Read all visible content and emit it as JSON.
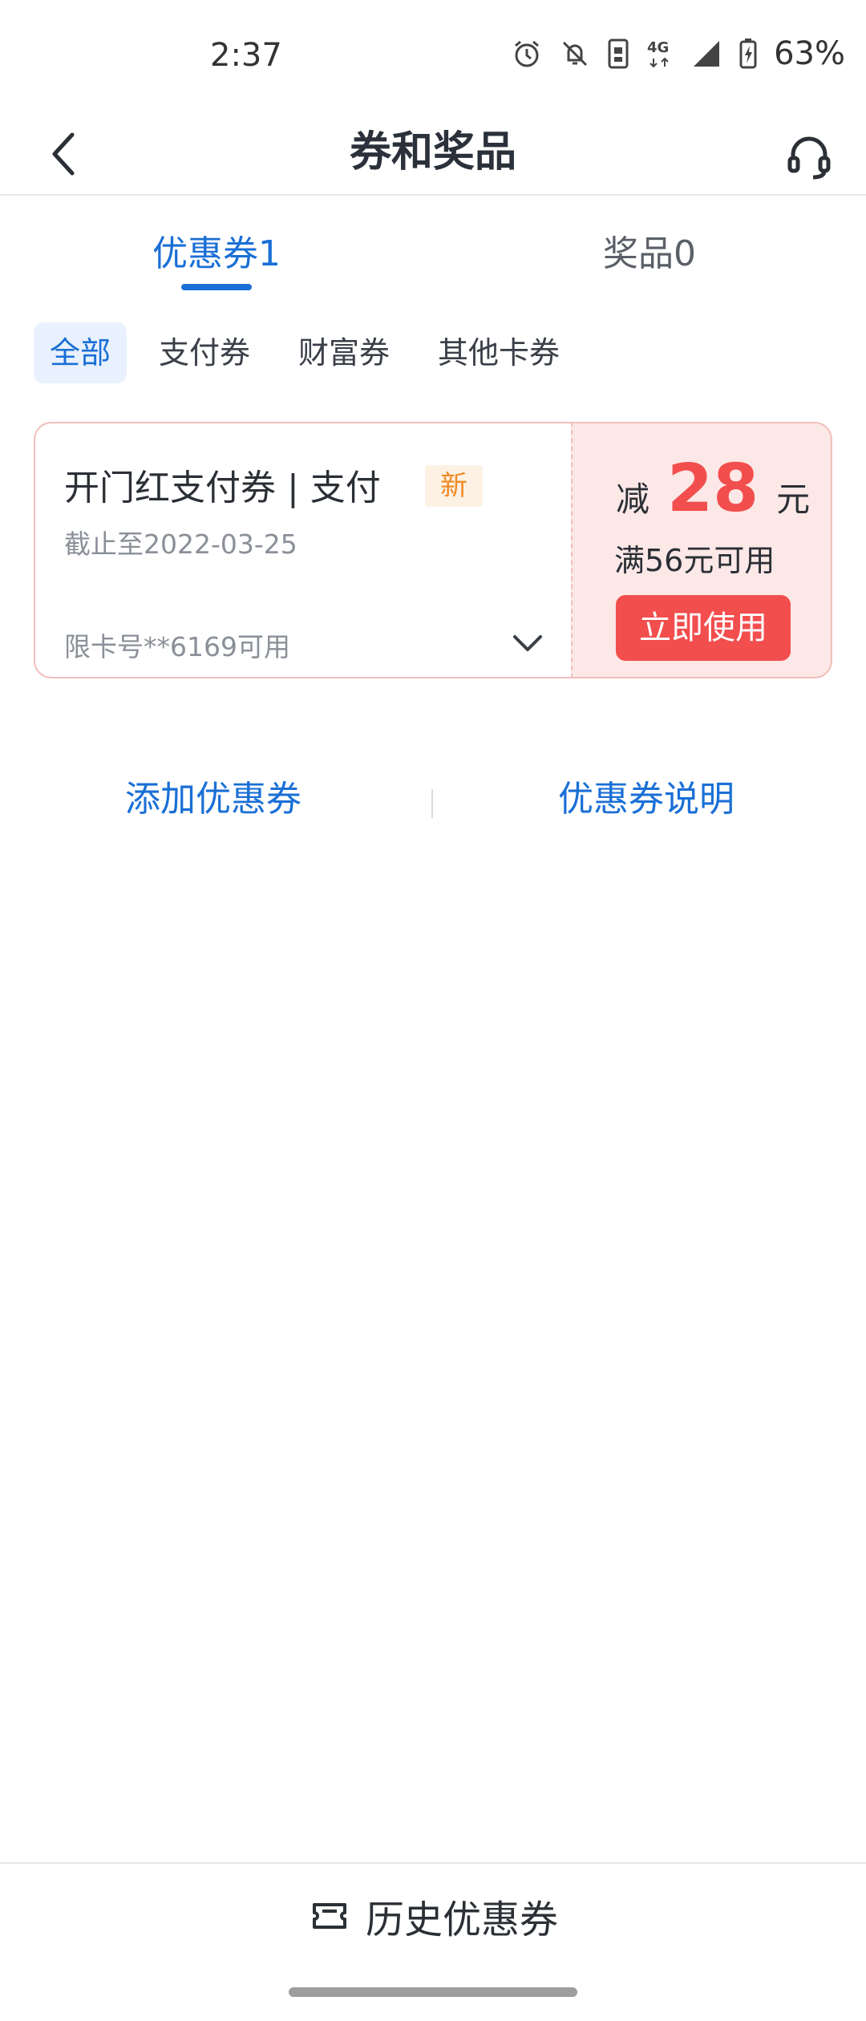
{
  "status_bar": {
    "time": "2:37",
    "network": "4G",
    "battery": "63%",
    "icons": [
      "alarm-icon",
      "mute-icon",
      "sim-icon",
      "network-4g-icon",
      "signal-icon",
      "battery-charging-icon"
    ]
  },
  "header": {
    "title": "券和奖品",
    "back_icon": "chevron-left-icon",
    "service_icon": "headset-icon"
  },
  "tabs": [
    {
      "label": "优惠券1",
      "active": true
    },
    {
      "label": "奖品0",
      "active": false
    }
  ],
  "filters": [
    {
      "label": "全部",
      "active": true
    },
    {
      "label": "支付券",
      "active": false
    },
    {
      "label": "财富券",
      "active": false
    },
    {
      "label": "其他卡券",
      "active": false
    }
  ],
  "coupon": {
    "name": "开门红支付券 | 支付",
    "badge": "新",
    "expire": "截止至2022-03-25",
    "card_limit": "限卡号**6169可用",
    "prefix": "减",
    "amount": "28",
    "unit": "元",
    "threshold": "满56元可用",
    "use_label": "立即使用"
  },
  "links": {
    "add_label": "添加优惠券",
    "explain_label": "优惠券说明"
  },
  "footer": {
    "history_label": "历史优惠券",
    "history_icon": "ticket-icon"
  },
  "colors": {
    "accent": "#1a6fd6",
    "coupon_red": "#f24e4e",
    "coupon_bg": "#fce8e6",
    "badge_orange": "#f08a24"
  }
}
